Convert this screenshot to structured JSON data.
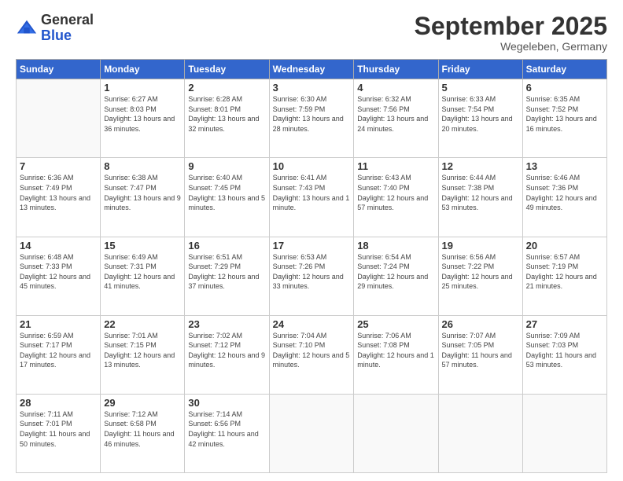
{
  "logo": {
    "general": "General",
    "blue": "Blue"
  },
  "header": {
    "month": "September 2025",
    "location": "Wegeleben, Germany"
  },
  "days_of_week": [
    "Sunday",
    "Monday",
    "Tuesday",
    "Wednesday",
    "Thursday",
    "Friday",
    "Saturday"
  ],
  "weeks": [
    [
      {
        "day": "",
        "sunrise": "",
        "sunset": "",
        "daylight": ""
      },
      {
        "day": "1",
        "sunrise": "Sunrise: 6:27 AM",
        "sunset": "Sunset: 8:03 PM",
        "daylight": "Daylight: 13 hours and 36 minutes."
      },
      {
        "day": "2",
        "sunrise": "Sunrise: 6:28 AM",
        "sunset": "Sunset: 8:01 PM",
        "daylight": "Daylight: 13 hours and 32 minutes."
      },
      {
        "day": "3",
        "sunrise": "Sunrise: 6:30 AM",
        "sunset": "Sunset: 7:59 PM",
        "daylight": "Daylight: 13 hours and 28 minutes."
      },
      {
        "day": "4",
        "sunrise": "Sunrise: 6:32 AM",
        "sunset": "Sunset: 7:56 PM",
        "daylight": "Daylight: 13 hours and 24 minutes."
      },
      {
        "day": "5",
        "sunrise": "Sunrise: 6:33 AM",
        "sunset": "Sunset: 7:54 PM",
        "daylight": "Daylight: 13 hours and 20 minutes."
      },
      {
        "day": "6",
        "sunrise": "Sunrise: 6:35 AM",
        "sunset": "Sunset: 7:52 PM",
        "daylight": "Daylight: 13 hours and 16 minutes."
      }
    ],
    [
      {
        "day": "7",
        "sunrise": "Sunrise: 6:36 AM",
        "sunset": "Sunset: 7:49 PM",
        "daylight": "Daylight: 13 hours and 13 minutes."
      },
      {
        "day": "8",
        "sunrise": "Sunrise: 6:38 AM",
        "sunset": "Sunset: 7:47 PM",
        "daylight": "Daylight: 13 hours and 9 minutes."
      },
      {
        "day": "9",
        "sunrise": "Sunrise: 6:40 AM",
        "sunset": "Sunset: 7:45 PM",
        "daylight": "Daylight: 13 hours and 5 minutes."
      },
      {
        "day": "10",
        "sunrise": "Sunrise: 6:41 AM",
        "sunset": "Sunset: 7:43 PM",
        "daylight": "Daylight: 13 hours and 1 minute."
      },
      {
        "day": "11",
        "sunrise": "Sunrise: 6:43 AM",
        "sunset": "Sunset: 7:40 PM",
        "daylight": "Daylight: 12 hours and 57 minutes."
      },
      {
        "day": "12",
        "sunrise": "Sunrise: 6:44 AM",
        "sunset": "Sunset: 7:38 PM",
        "daylight": "Daylight: 12 hours and 53 minutes."
      },
      {
        "day": "13",
        "sunrise": "Sunrise: 6:46 AM",
        "sunset": "Sunset: 7:36 PM",
        "daylight": "Daylight: 12 hours and 49 minutes."
      }
    ],
    [
      {
        "day": "14",
        "sunrise": "Sunrise: 6:48 AM",
        "sunset": "Sunset: 7:33 PM",
        "daylight": "Daylight: 12 hours and 45 minutes."
      },
      {
        "day": "15",
        "sunrise": "Sunrise: 6:49 AM",
        "sunset": "Sunset: 7:31 PM",
        "daylight": "Daylight: 12 hours and 41 minutes."
      },
      {
        "day": "16",
        "sunrise": "Sunrise: 6:51 AM",
        "sunset": "Sunset: 7:29 PM",
        "daylight": "Daylight: 12 hours and 37 minutes."
      },
      {
        "day": "17",
        "sunrise": "Sunrise: 6:53 AM",
        "sunset": "Sunset: 7:26 PM",
        "daylight": "Daylight: 12 hours and 33 minutes."
      },
      {
        "day": "18",
        "sunrise": "Sunrise: 6:54 AM",
        "sunset": "Sunset: 7:24 PM",
        "daylight": "Daylight: 12 hours and 29 minutes."
      },
      {
        "day": "19",
        "sunrise": "Sunrise: 6:56 AM",
        "sunset": "Sunset: 7:22 PM",
        "daylight": "Daylight: 12 hours and 25 minutes."
      },
      {
        "day": "20",
        "sunrise": "Sunrise: 6:57 AM",
        "sunset": "Sunset: 7:19 PM",
        "daylight": "Daylight: 12 hours and 21 minutes."
      }
    ],
    [
      {
        "day": "21",
        "sunrise": "Sunrise: 6:59 AM",
        "sunset": "Sunset: 7:17 PM",
        "daylight": "Daylight: 12 hours and 17 minutes."
      },
      {
        "day": "22",
        "sunrise": "Sunrise: 7:01 AM",
        "sunset": "Sunset: 7:15 PM",
        "daylight": "Daylight: 12 hours and 13 minutes."
      },
      {
        "day": "23",
        "sunrise": "Sunrise: 7:02 AM",
        "sunset": "Sunset: 7:12 PM",
        "daylight": "Daylight: 12 hours and 9 minutes."
      },
      {
        "day": "24",
        "sunrise": "Sunrise: 7:04 AM",
        "sunset": "Sunset: 7:10 PM",
        "daylight": "Daylight: 12 hours and 5 minutes."
      },
      {
        "day": "25",
        "sunrise": "Sunrise: 7:06 AM",
        "sunset": "Sunset: 7:08 PM",
        "daylight": "Daylight: 12 hours and 1 minute."
      },
      {
        "day": "26",
        "sunrise": "Sunrise: 7:07 AM",
        "sunset": "Sunset: 7:05 PM",
        "daylight": "Daylight: 11 hours and 57 minutes."
      },
      {
        "day": "27",
        "sunrise": "Sunrise: 7:09 AM",
        "sunset": "Sunset: 7:03 PM",
        "daylight": "Daylight: 11 hours and 53 minutes."
      }
    ],
    [
      {
        "day": "28",
        "sunrise": "Sunrise: 7:11 AM",
        "sunset": "Sunset: 7:01 PM",
        "daylight": "Daylight: 11 hours and 50 minutes."
      },
      {
        "day": "29",
        "sunrise": "Sunrise: 7:12 AM",
        "sunset": "Sunset: 6:58 PM",
        "daylight": "Daylight: 11 hours and 46 minutes."
      },
      {
        "day": "30",
        "sunrise": "Sunrise: 7:14 AM",
        "sunset": "Sunset: 6:56 PM",
        "daylight": "Daylight: 11 hours and 42 minutes."
      },
      {
        "day": "",
        "sunrise": "",
        "sunset": "",
        "daylight": ""
      },
      {
        "day": "",
        "sunrise": "",
        "sunset": "",
        "daylight": ""
      },
      {
        "day": "",
        "sunrise": "",
        "sunset": "",
        "daylight": ""
      },
      {
        "day": "",
        "sunrise": "",
        "sunset": "",
        "daylight": ""
      }
    ]
  ]
}
